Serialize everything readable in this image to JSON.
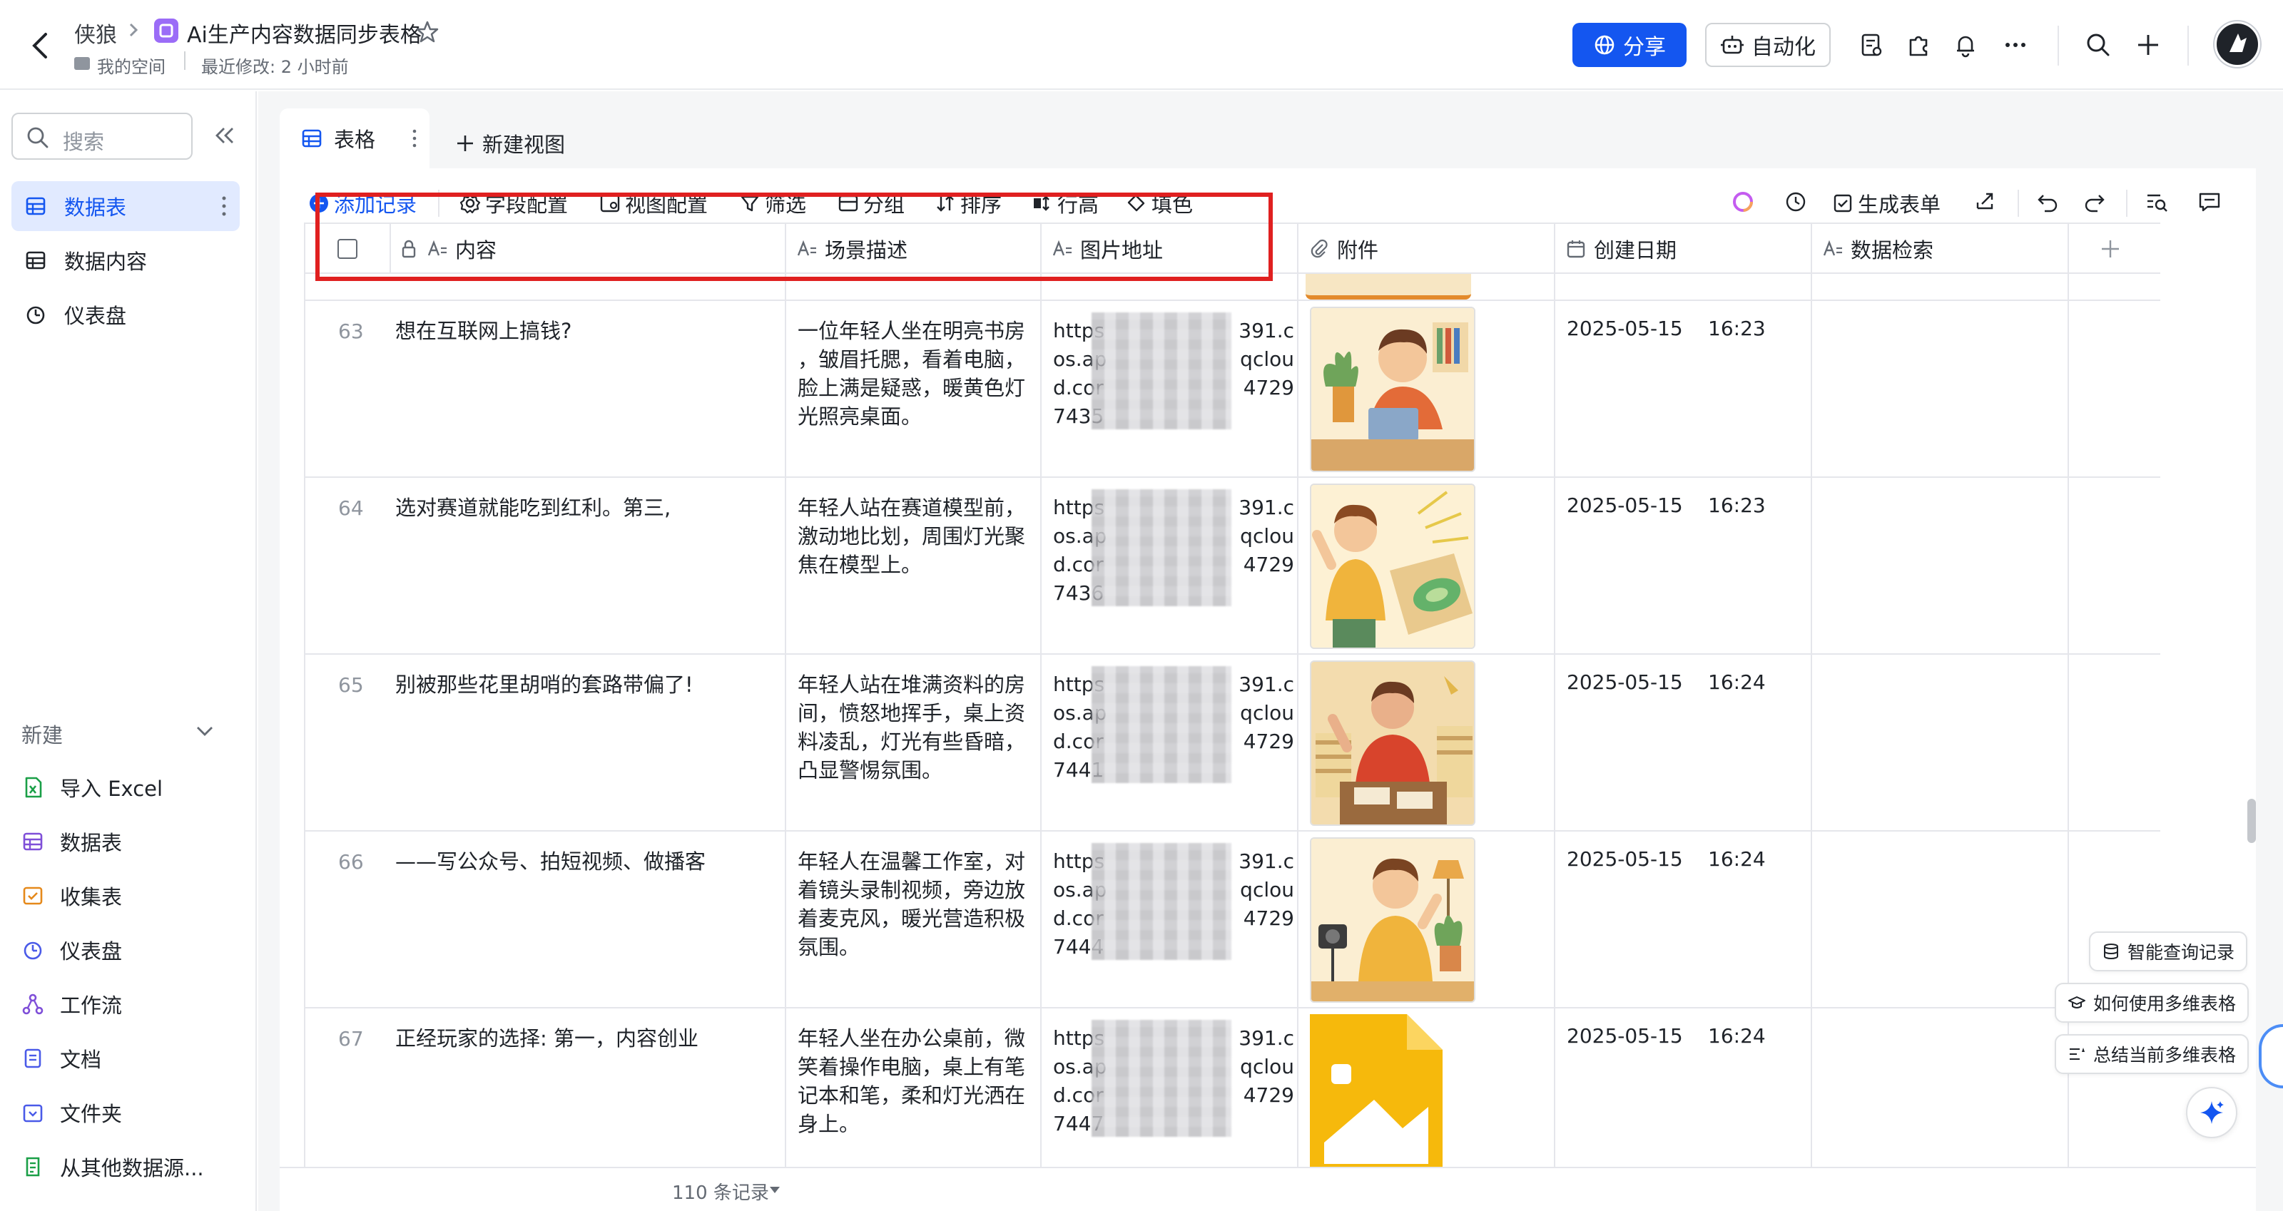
{
  "header": {
    "breadcrumb_parent": "侠狼",
    "doc_title": "Ai生产内容数据同步表格",
    "space": "我的空间",
    "last_modified": "最近修改: 2 小时前",
    "share_label": "分享",
    "automation_label": "自动化"
  },
  "sidebar": {
    "search_placeholder": "搜索",
    "items": [
      {
        "label": "数据表"
      },
      {
        "label": "数据内容"
      },
      {
        "label": "仪表盘"
      }
    ],
    "new_heading": "新建",
    "new_items": [
      {
        "label": "导入 Excel"
      },
      {
        "label": "数据表"
      },
      {
        "label": "收集表"
      },
      {
        "label": "仪表盘"
      },
      {
        "label": "工作流"
      },
      {
        "label": "文档"
      },
      {
        "label": "文件夹"
      },
      {
        "label": "从其他数据源..."
      }
    ]
  },
  "tabs": {
    "active": "表格",
    "new_view": "新建视图"
  },
  "toolbar": {
    "add_record": "添加记录",
    "field_config": "字段配置",
    "view_config": "视图配置",
    "filter": "筛选",
    "group": "分组",
    "sort": "排序",
    "row_height": "行高",
    "fill_color": "填色",
    "generate_form": "生成表单"
  },
  "columns": [
    "内容",
    "场景描述",
    "图片地址",
    "附件",
    "创建日期",
    "数据检索"
  ],
  "rows": [
    {
      "num": "63",
      "content": "想在互联网上搞钱?",
      "scene": [
        "一位年轻人坐在明亮书房",
        "，皱眉托腮，看着电脑，",
        "脸上满是疑惑，暖黄色灯",
        "光照亮桌面。"
      ],
      "url_l": [
        "https",
        "os.ap",
        "d.cor",
        "7435"
      ],
      "url_r": [
        "391.c",
        "qclou",
        "4729",
        ""
      ],
      "date": "2025-05-15",
      "time": "16:23"
    },
    {
      "num": "64",
      "content": "选对赛道就能吃到红利。第三,",
      "scene": [
        "年轻人站在赛道模型前，",
        "激动地比划，周围灯光聚",
        "焦在模型上。"
      ],
      "url_l": [
        "https",
        "os.ap",
        "d.cor",
        "7436"
      ],
      "url_r": [
        "391.c",
        "qclou",
        "4729",
        ""
      ],
      "date": "2025-05-15",
      "time": "16:23"
    },
    {
      "num": "65",
      "content": "别被那些花里胡哨的套路带偏了!",
      "scene": [
        "年轻人站在堆满资料的房",
        "间，愤怒地挥手，桌上资",
        "料凌乱，灯光有些昏暗，",
        "凸显警惕氛围。"
      ],
      "url_l": [
        "https",
        "os.ap",
        "d.cor",
        "7441"
      ],
      "url_r": [
        "391.c",
        "qclou",
        "4729",
        ""
      ],
      "date": "2025-05-15",
      "time": "16:24"
    },
    {
      "num": "66",
      "content": "——写公众号、拍短视频、做播客",
      "scene": [
        "年轻人在温馨工作室，对",
        "着镜头录制视频，旁边放",
        "着麦克风，暖光营造积极",
        "氛围。"
      ],
      "url_l": [
        "https",
        "os.ap",
        "d.cor",
        "7444"
      ],
      "url_r": [
        "391.c",
        "qclou",
        "4729",
        ""
      ],
      "date": "2025-05-15",
      "time": "16:24"
    },
    {
      "num": "67",
      "content": "正经玩家的选择: 第一，内容创业",
      "scene": [
        "年轻人坐在办公桌前，微",
        "笑着操作电脑，桌上有笔",
        "记本和笔，柔和灯光洒在",
        "身上。"
      ],
      "url_l": [
        "https",
        "os.ap",
        "d.cor",
        "7447"
      ],
      "url_r": [
        "391.c",
        "qclou",
        "4729",
        ""
      ],
      "date": "2025-05-15",
      "time": "16:24"
    }
  ],
  "footer": {
    "record_count": "110 条记录"
  },
  "ai_panel": {
    "smart_query": "智能查询记录",
    "how_to_use": "如何使用多维表格",
    "summarize": "总结当前多维表格"
  },
  "colors": {
    "brand": "#1456f0",
    "highlight_box": "#e02020",
    "active_nav_bg": "#e1eaff"
  }
}
